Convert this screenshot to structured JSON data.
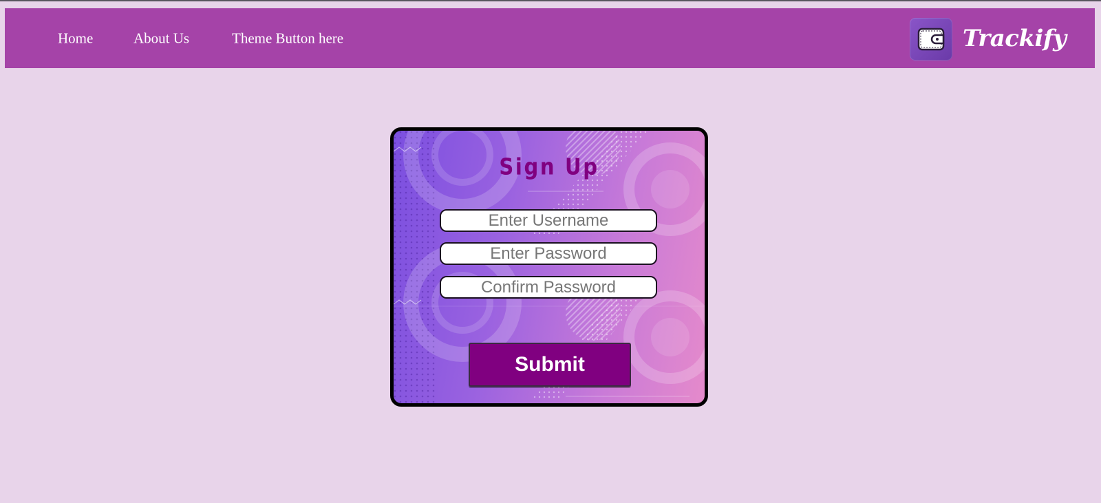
{
  "nav": {
    "links": [
      "Home",
      "About Us",
      "Theme Button here"
    ]
  },
  "brand": {
    "name": "Trackify",
    "logo_icon": "wallet-icon"
  },
  "signup": {
    "title": "Sign Up",
    "username_placeholder": "Enter Username",
    "password_placeholder": "Enter Password",
    "confirm_placeholder": "Confirm Password",
    "submit_label": "Submit"
  },
  "colors": {
    "page_background": "#e8d4ea",
    "navbar": "#a543a8",
    "title_text": "#800080",
    "submit_button": "#800080"
  }
}
